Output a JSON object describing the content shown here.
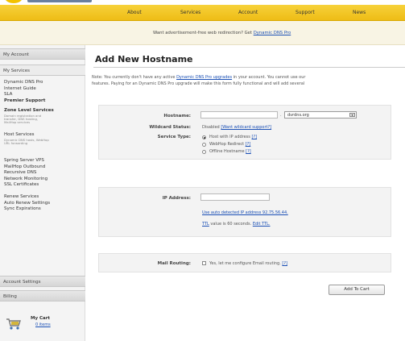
{
  "nav": {
    "items": [
      "About",
      "Services",
      "Account",
      "Support",
      "News"
    ]
  },
  "ad": {
    "text": "Want advertisement-free web redirection? Get",
    "link": "Dynamic DNS Pro"
  },
  "sidebar": {
    "header_account": "My Account",
    "header_services": "My Services",
    "group1": [
      "Dynamic DNS Pro",
      "Internet Guide",
      "SLA",
      "Premier Support"
    ],
    "zone_title": "Zone Level Services",
    "zone_desc": [
      "Domain registration and",
      "transfer, DNS hosting,",
      "MailHop services"
    ],
    "host_title": "Host Services",
    "host_desc": [
      "Dynamic DNS hosts, WebHop",
      "URL forwarding"
    ],
    "group2": [
      "Spring Server VPS",
      "MailHop Outbound",
      "Recursive DNS",
      "Network Monitoring",
      "SSL Certificates"
    ],
    "group3": [
      "Renew Services",
      "Auto Renew Settings",
      "Sync Expirations"
    ],
    "header_settings": "Account Settings",
    "header_billing": "Billing",
    "cart_title": "My Cart",
    "cart_link": "0 items"
  },
  "main": {
    "title": "Add New Hostname",
    "note_line1_a": "Note: You currently don't have any active",
    "note_line1_link": "Dynamic DNS Pro upgrades",
    "note_line1_b": "in your account. You cannot use our",
    "note_line2": "features. Paying for an Dynamic DNS Pro upgrade will make this form fully functional and will add several",
    "hostname_label": "Hostname:",
    "domain_selected": "dvrdns.org",
    "wildcard_label": "Wildcard Status:",
    "wildcard_value": "Disabled",
    "wildcard_link": "[Want wildcard support?]",
    "service_label": "Service Type:",
    "service_options": [
      "Host with IP address",
      "WebHop Redirect",
      "Offline Hostname"
    ],
    "help_mark": "[?]",
    "ip_label": "IP Address:",
    "ip_auto_link": "Use auto detected IP address 92.75.56.44.",
    "ttl_link": "TTL",
    "ttl_text": "value is 60 seconds.",
    "ttl_edit": "Edit TTL.",
    "mail_label": "Mail Routing:",
    "mail_text": "Yes, let me configure Email routing.",
    "add_button": "Add To Cart"
  }
}
